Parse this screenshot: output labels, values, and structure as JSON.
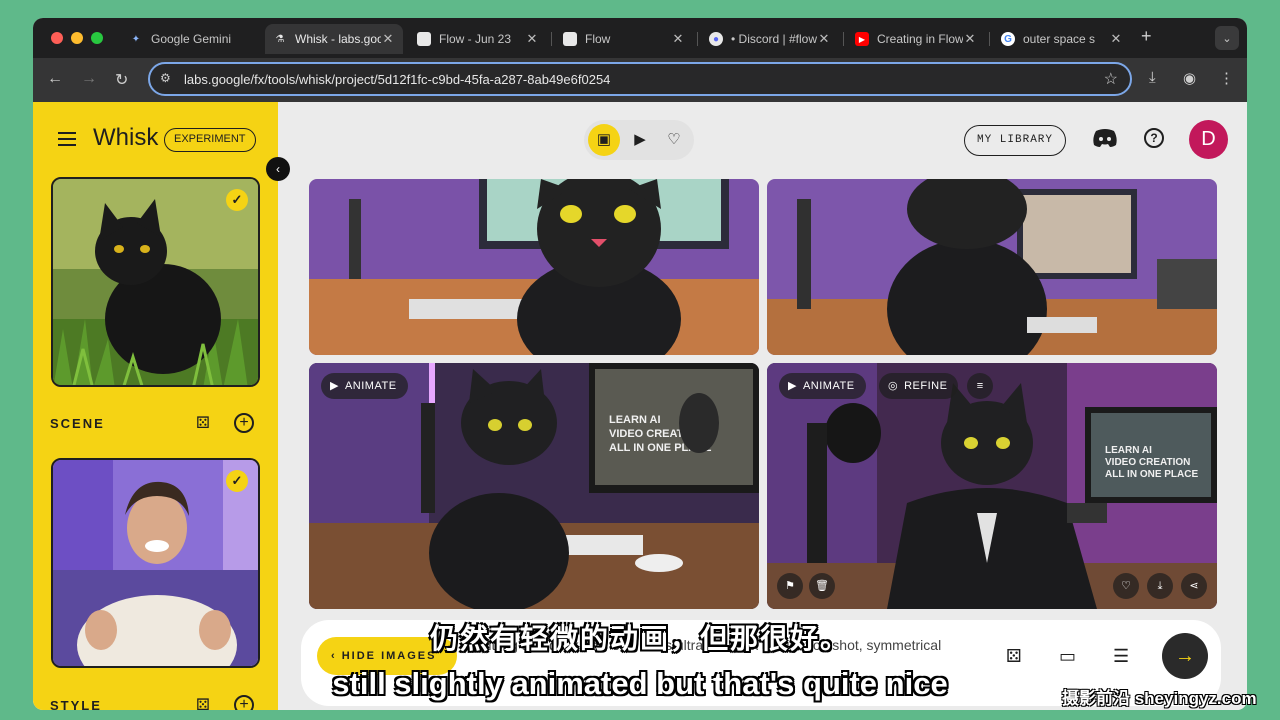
{
  "browser": {
    "tabs": [
      {
        "title": "Google Gemini",
        "favicon": "gemini-sparkle-icon"
      },
      {
        "title": "Whisk - labs.google",
        "favicon": "flask-icon",
        "active": true
      },
      {
        "title": "Flow - Jun 23",
        "favicon": "page-icon"
      },
      {
        "title": "Flow",
        "favicon": "page-icon"
      },
      {
        "title": "• Discord | #flow",
        "favicon": "discord-icon"
      },
      {
        "title": "Creating in Flow",
        "favicon": "youtube-icon"
      },
      {
        "title": "outer space s",
        "favicon": "google-icon"
      }
    ],
    "url": "labs.google/fx/tools/whisk/project/5d12f1fc-c9bd-45fa-a287-8ab49e6f0254"
  },
  "sidebar": {
    "app_name": "Whisk",
    "badge": "EXPERIMENT",
    "sections": [
      {
        "label": "SCENE"
      },
      {
        "label": "STYLE"
      }
    ]
  },
  "header": {
    "library_label": "MY LIBRARY",
    "avatar_initial": "D",
    "help_label": "?"
  },
  "gallery": {
    "animate_label": "ANIMATE",
    "refine_label": "REFINE",
    "poster_text": "LEARN AI VIDEO CREATION ALL IN ONE PLACE"
  },
  "prompt": {
    "hide_label": "HIDE IMAGES",
    "text": "Sitting at a desk, this one looks ultra-realistic. straight on shot, symmetrical"
  },
  "subtitles": {
    "cn": "仍然有轻微的动画，但那很好。",
    "en": "still slightly animated but that's quite nice"
  },
  "watermark": "摄影前沿 sheyingyz.com",
  "colors": {
    "accent": "#f5d314",
    "avatar": "#c2185b",
    "background": "#ebebeb"
  }
}
